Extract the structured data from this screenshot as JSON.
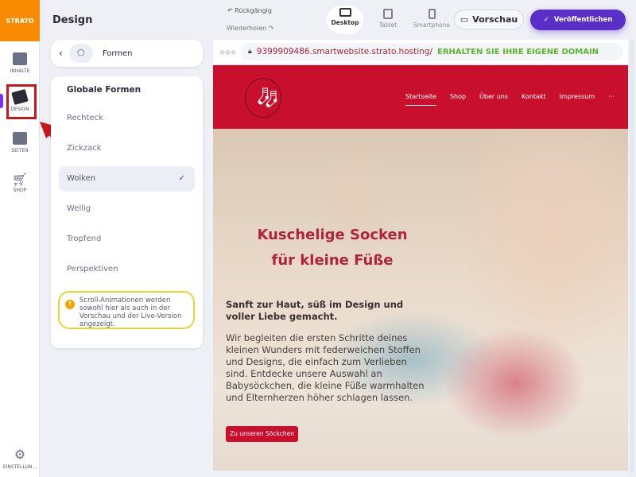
{
  "rail": {
    "logo": "STRATO",
    "items": [
      {
        "label": "INHALTE"
      },
      {
        "label": "DESIGN"
      },
      {
        "label": "SEITEN"
      },
      {
        "label": "SHOP"
      },
      {
        "label": "EINSTELLUN..."
      }
    ]
  },
  "panel": {
    "title": "Design",
    "section": "Formen",
    "list_title": "Globale Formen",
    "options": [
      {
        "label": "Rechteck"
      },
      {
        "label": "Zickzack"
      },
      {
        "label": "Wolken",
        "selected": true
      },
      {
        "label": "Wellig"
      },
      {
        "label": "Tropfend"
      },
      {
        "label": "Perspektiven"
      }
    ],
    "check": "✓",
    "note": "Scroll-Animationen werden sowohl hier als auch in der Vorschau und der Live-Version angezeigt.",
    "note_icon": "!"
  },
  "toolbar": {
    "undo": "Rückgängig",
    "redo": "Wiederholen",
    "devices": [
      {
        "label": "Desktop"
      },
      {
        "label": "Tablet"
      },
      {
        "label": "Smartphone"
      }
    ],
    "preview": "Vorschau",
    "publish": "Veröffentlichen"
  },
  "address": {
    "url": "9399909486.smartwebsite.strato.hosting/",
    "promo": "ERHALTEN SIE IHRE EIGENE DOMAIN"
  },
  "site": {
    "nav": [
      "Startseite",
      "Shop",
      "Über uns",
      "Kontakt",
      "Impressum",
      "···"
    ],
    "headline1": "Kuschelige Socken",
    "headline2": "für kleine Füße",
    "lead": "Sanft zur Haut, süß im Design und voller Liebe gemacht.",
    "body": "Wir begleiten die ersten Schritte deines kleinen Wunders mit federweichen Stoffen und Designs, die einfach zum Verlieben sind. Entdecke unsere Auswahl an Babysöckchen, die kleine Füße warmhalten und Elternherzen höher schlagen lassen.",
    "cta": "Zu unseren Söckchen"
  },
  "colors": {
    "accent": "#5a2fc8",
    "brand": "#f98b00",
    "site_red": "#c8102e",
    "annotation": "#c8161d"
  }
}
